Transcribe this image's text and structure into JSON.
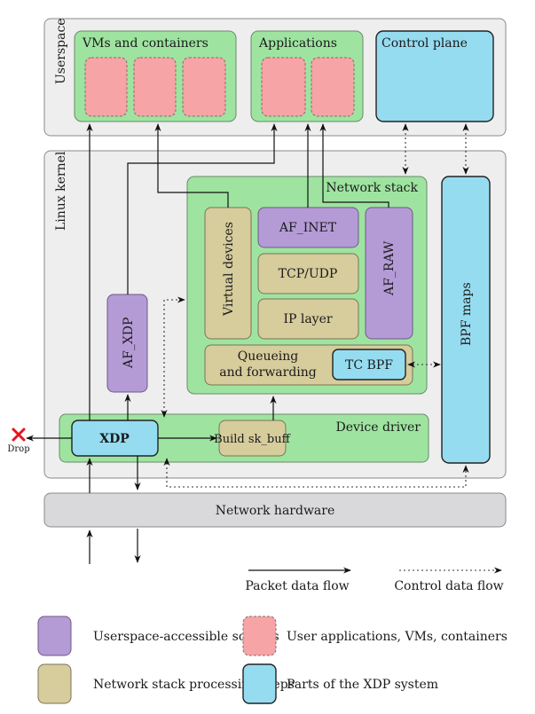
{
  "colors": {
    "region_bg": "#eeeeee",
    "group_green": "#9ee4a0",
    "socket_purple": "#b59bd6",
    "stack_tan": "#d6cc9c",
    "xdp_blue": "#96dcf0",
    "app_pink": "#f6a4a6",
    "hardware_gray": "#d9d9db",
    "drop_red": "#e8141c"
  },
  "regions": {
    "userspace": "Userspace",
    "kernel": "Linux kernel"
  },
  "userspace": {
    "vms_title": "VMs and containers",
    "apps_title": "Applications",
    "control_plane": "Control plane"
  },
  "kernel": {
    "network_stack": "Network stack",
    "virtual_devices": "Virtual devices",
    "af_inet": "AF_INET",
    "tcp_udp": "TCP/UDP",
    "ip_layer": "IP layer",
    "af_raw": "AF_RAW",
    "queueing_line1": "Queueing",
    "queueing_line2": "and forwarding",
    "tc_bpf": "TC BPF",
    "af_xdp": "AF_XDP",
    "bpf_maps": "BPF maps",
    "device_driver": "Device driver",
    "xdp": "XDP",
    "build_skb": "Build sk_buff",
    "drop": "Drop"
  },
  "hardware": {
    "label": "Network hardware"
  },
  "flow_legend": {
    "packet": "Packet data flow",
    "control": "Control data flow"
  },
  "legend": [
    {
      "label": "Userspace-accessible sockets",
      "kind": "socket"
    },
    {
      "label": "User applications, VMs, containers",
      "kind": "app"
    },
    {
      "label": "Network stack processing steps",
      "kind": "stack"
    },
    {
      "label": "Parts of the XDP system",
      "kind": "xdp"
    }
  ]
}
